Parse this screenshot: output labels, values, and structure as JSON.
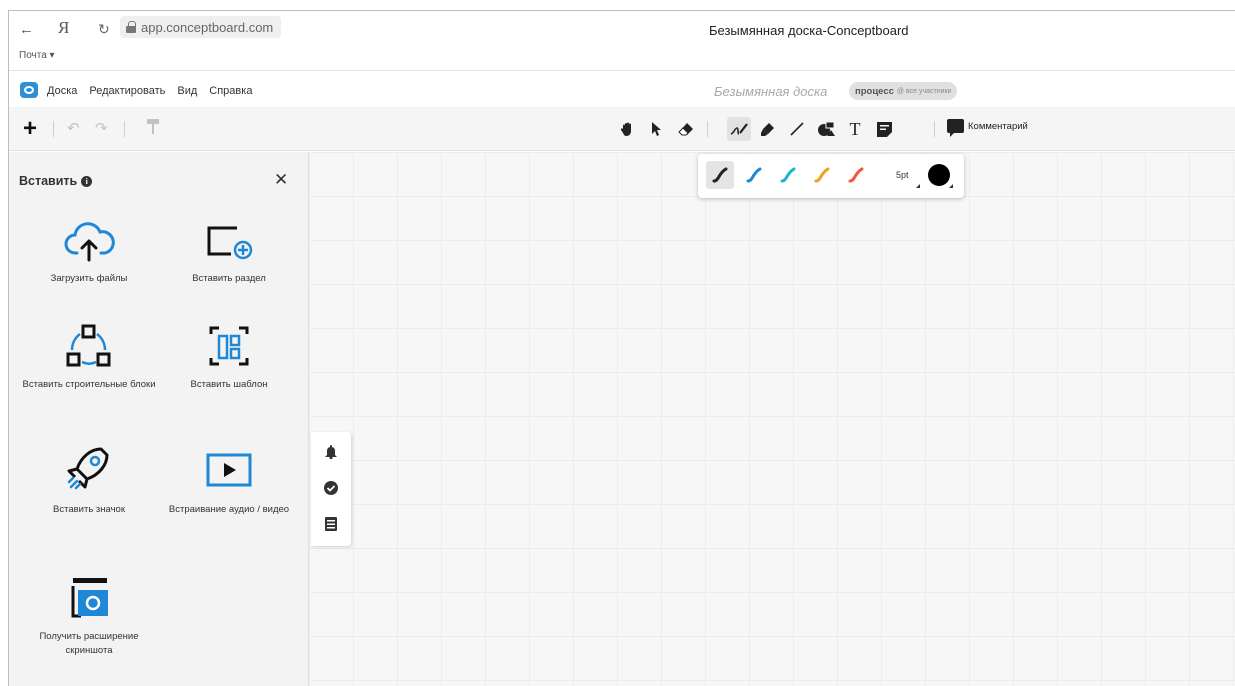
{
  "browser": {
    "back_glyph": "←",
    "ya_logo": "Я",
    "reload_glyph": "↻",
    "url": "app.conceptboard.com",
    "mail_label": "Почта ▾",
    "page_title": "Безымянная доска-Conceptboard"
  },
  "menu": {
    "items": [
      "Доска",
      "Редактировать",
      "Вид",
      "Справка"
    ],
    "board_title": "Безымянная доска",
    "badge_main": "процесс",
    "badge_sub": "@ все участники"
  },
  "toolbar": {
    "comment_label": "Комментарий",
    "tools": [
      "hand-icon",
      "pointer-icon",
      "eraser-icon",
      "pen-icon",
      "highlighter-icon",
      "line-icon",
      "shape-icon",
      "text-icon",
      "sticky-note-icon"
    ]
  },
  "pen_popup": {
    "size_label": "5pt",
    "colors": [
      "#222222",
      "#1e88d6",
      "#1fb5c9",
      "#f0a020",
      "#ef5a3a"
    ],
    "selected_color": "#000000"
  },
  "insert_panel": {
    "title": "Вставить",
    "items": [
      {
        "label": "Загрузить файлы",
        "icon": "cloud-upload-icon"
      },
      {
        "label": "Вставить раздел",
        "icon": "section-add-icon"
      },
      {
        "label": "Вставить строительные блоки",
        "icon": "building-blocks-icon"
      },
      {
        "label": "Вставить шаблон",
        "icon": "template-icon"
      },
      {
        "label": "Вставить значок",
        "icon": "rocket-icon"
      },
      {
        "label": "Встраивание аудио / видео",
        "icon": "video-play-icon"
      },
      {
        "label": "Получить расширение скриншота",
        "icon": "screenshot-icon"
      }
    ]
  },
  "side_bar": {
    "icons": [
      "bell-icon",
      "check-circle-icon",
      "list-icon"
    ]
  },
  "colors": {
    "accent": "#1e88d6",
    "panel_bg": "#f3f3f3",
    "canvas_bg": "#f7f7f7"
  }
}
